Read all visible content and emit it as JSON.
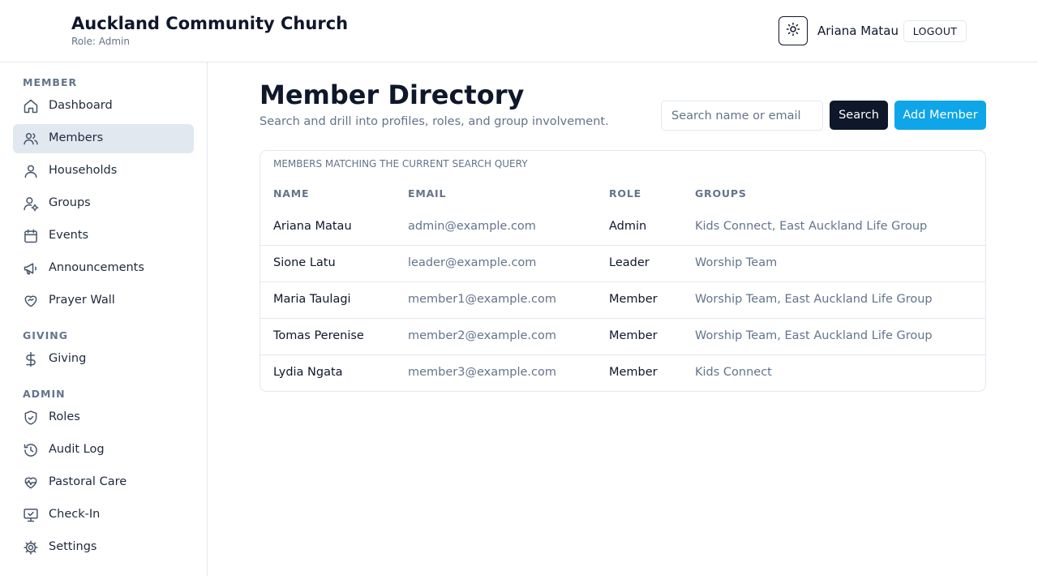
{
  "header": {
    "church_name": "Auckland Community Church",
    "role_line": "Role: Admin",
    "user_name": "Ariana Matau",
    "logout_label": "LOGOUT",
    "theme_icon": "sun-icon"
  },
  "sidebar": {
    "sections": [
      {
        "label": "MEMBER",
        "items": [
          {
            "label": "Dashboard",
            "icon": "home-icon",
            "active": false
          },
          {
            "label": "Members",
            "icon": "users-icon",
            "active": true
          },
          {
            "label": "Households",
            "icon": "user-icon",
            "active": false
          },
          {
            "label": "Groups",
            "icon": "user-gear-icon",
            "active": false
          },
          {
            "label": "Events",
            "icon": "calendar-icon",
            "active": false
          },
          {
            "label": "Announcements",
            "icon": "megaphone-icon",
            "active": false
          },
          {
            "label": "Prayer Wall",
            "icon": "heart-handshake-icon",
            "active": false
          }
        ]
      },
      {
        "label": "GIVING",
        "items": [
          {
            "label": "Giving",
            "icon": "dollar-icon",
            "active": false
          }
        ]
      },
      {
        "label": "ADMIN",
        "items": [
          {
            "label": "Roles",
            "icon": "shield-check-icon",
            "active": false
          },
          {
            "label": "Audit Log",
            "icon": "history-icon",
            "active": false
          },
          {
            "label": "Pastoral Care",
            "icon": "heart-pulse-icon",
            "active": false
          },
          {
            "label": "Check-In",
            "icon": "monitor-check-icon",
            "active": false
          },
          {
            "label": "Settings",
            "icon": "gear-icon",
            "active": false
          }
        ]
      }
    ]
  },
  "main": {
    "title": "Member Directory",
    "subtitle": "Search and drill into profiles, roles, and group involvement.",
    "search": {
      "placeholder": "Search name or email",
      "value": ""
    },
    "search_button": "Search",
    "add_button": "Add Member",
    "table": {
      "caption": "MEMBERS MATCHING THE CURRENT SEARCH QUERY",
      "columns": [
        "NAME",
        "EMAIL",
        "ROLE",
        "GROUPS"
      ],
      "rows": [
        {
          "name": "Ariana Matau",
          "email": "admin@example.com",
          "role": "Admin",
          "groups": "Kids Connect, East Auckland Life Group"
        },
        {
          "name": "Sione Latu",
          "email": "leader@example.com",
          "role": "Leader",
          "groups": "Worship Team"
        },
        {
          "name": "Maria Taulagi",
          "email": "member1@example.com",
          "role": "Member",
          "groups": "Worship Team, East Auckland Life Group"
        },
        {
          "name": "Tomas Perenise",
          "email": "member2@example.com",
          "role": "Member",
          "groups": "Worship Team, East Auckland Life Group"
        },
        {
          "name": "Lydia Ngata",
          "email": "member3@example.com",
          "role": "Member",
          "groups": "Kids Connect"
        }
      ]
    }
  },
  "colors": {
    "primary_dark": "#0f172a",
    "accent": "#0ea5e9",
    "muted_text": "#64748b",
    "border": "#e2e8f0",
    "active_nav_bg": "#e2e8f0"
  }
}
